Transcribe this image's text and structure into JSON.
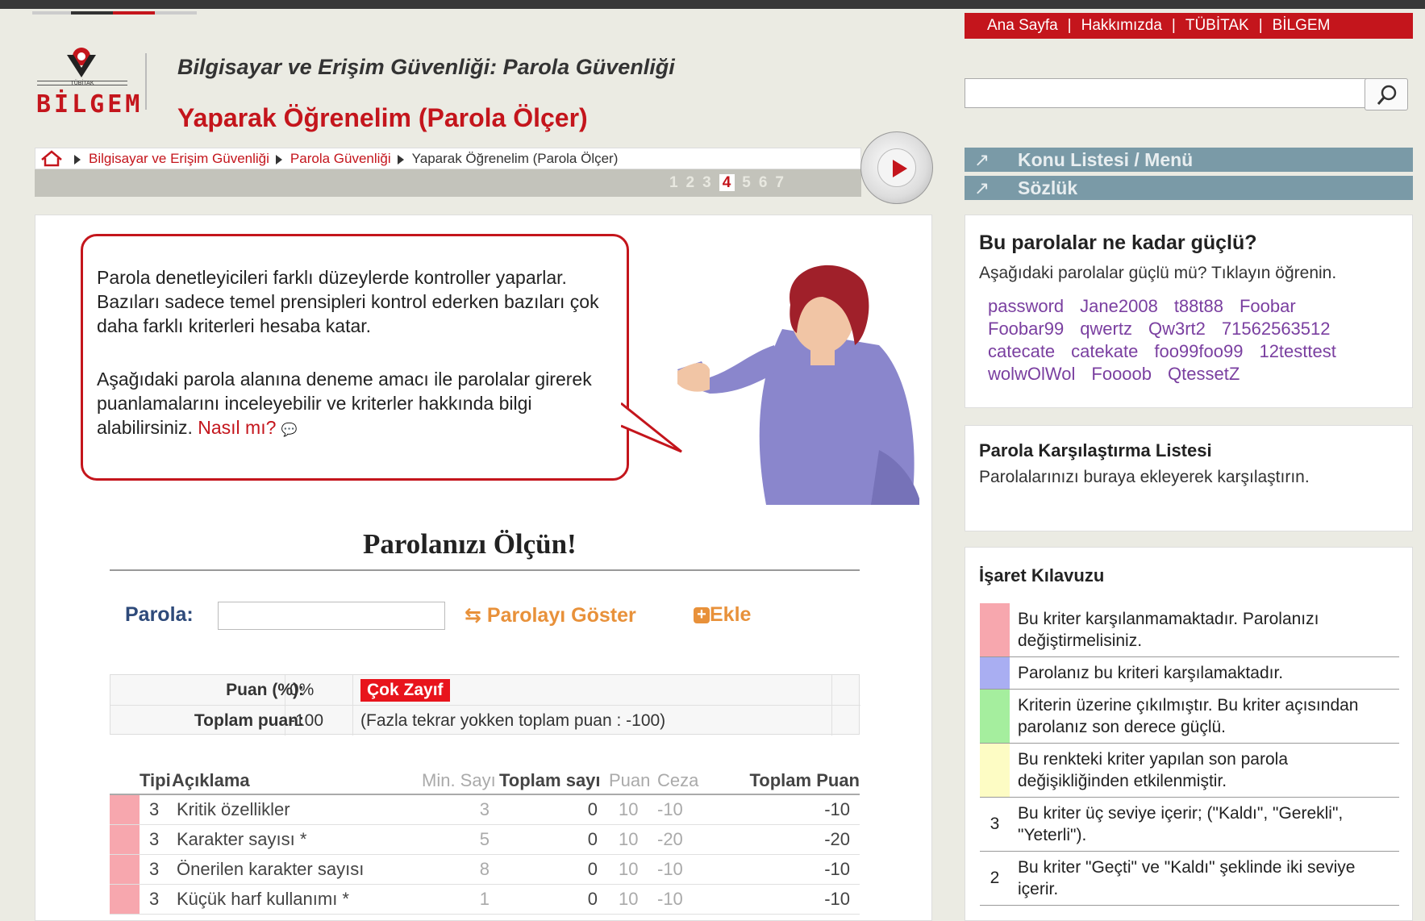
{
  "header": {
    "logo_small": "TÜBİTAK",
    "logo_text": "BİLGEM",
    "site_title": "Bilgisayar ve Erişim Güvenliği: Parola Güvenliği",
    "page_title": "Yaparak Öğrenelim (Parola Ölçer)"
  },
  "topnav": {
    "items": [
      "Ana Sayfa",
      "Hakkımızda",
      "TÜBİTAK",
      "BİLGEM"
    ],
    "separator": "|"
  },
  "search": {
    "placeholder": "",
    "value": ""
  },
  "breadcrumb": {
    "items": [
      "Bilgisayar ve Erişim Güvenliği",
      "Parola Güvenliği",
      "Yaparak Öğrenelim (Parola Ölçer)"
    ]
  },
  "pager": {
    "pages": [
      "1",
      "2",
      "3",
      "4",
      "5",
      "6",
      "7"
    ],
    "current": "4"
  },
  "bubble": {
    "para1": "Parola denetleyicileri farklı düzeylerde kontroller yaparlar. Bazıları sadece temel prensipleri kontrol ederken bazıları çok daha farklı kriterleri hesaba katar.",
    "para2": "Aşağıdaki parola alanına deneme amacı ile parolalar girerek puanlamalarını inceleyebilir ve kriterler hakkında bilgi alabilirsiniz.",
    "link": "Nasıl mı?"
  },
  "meter": {
    "title": "Parolanızı Ölçün!",
    "password_label": "Parola:",
    "password_value": "",
    "show_label": "Parolayı Göster",
    "add_label": "Ekle"
  },
  "score": {
    "percent_label": "Puan (%):",
    "percent_value": "0%",
    "strength": "Çok Zayıf",
    "total_label": "Toplam puan:",
    "total_value": "-100",
    "note": "(Fazla tekrar yokken toplam puan  :  -100)"
  },
  "criteria": {
    "headers": [
      "Tipi",
      "Açıklama",
      "Min. Sayı",
      "Toplam sayı",
      "Puan",
      "Ceza",
      "Toplam Puan"
    ],
    "rows": [
      {
        "type": "3",
        "desc": "Kritik özellikler",
        "min": "3",
        "count": "0",
        "point": "10",
        "penalty": "-10",
        "total": "-10"
      },
      {
        "type": "3",
        "desc": "Karakter sayısı *",
        "min": "5",
        "count": "0",
        "point": "10",
        "penalty": "-20",
        "total": "-20"
      },
      {
        "type": "3",
        "desc": "Önerilen karakter sayısı",
        "min": "8",
        "count": "0",
        "point": "10",
        "penalty": "-10",
        "total": "-10"
      },
      {
        "type": "3",
        "desc": "Küçük harf kullanımı *",
        "min": "1",
        "count": "0",
        "point": "10",
        "penalty": "-10",
        "total": "-10"
      }
    ],
    "row_color": "#f7a7ae"
  },
  "sidebar": {
    "menu": [
      "Konu Listesi / Menü",
      "Sözlük"
    ],
    "strength_panel": {
      "title": "Bu parolalar ne kadar güçlü?",
      "subtitle": "Aşağıdaki parolalar güçlü mü? Tıklayın öğrenin.",
      "passwords": [
        "password",
        "Jane2008",
        "t88t88",
        "Foobar",
        "Foobar99",
        "qwertz",
        "Qw3rt2",
        "71562563512",
        "catecate",
        "catekate",
        "foo99foo99",
        "12testtest",
        "wolwOlWol",
        "Foooob",
        "QtessetZ"
      ]
    },
    "compare_panel": {
      "title": "Parola Karşılaştırma Listesi",
      "text": "Parolalarınızı buraya ekleyerek karşılaştırın."
    },
    "legend_panel": {
      "title": "İşaret Kılavuzu",
      "items": [
        {
          "color": "#f7a7ae",
          "marker": "",
          "text": "Bu kriter karşılanmamaktadır. Parolanızı değiştirmelisiniz."
        },
        {
          "color": "#a9aef2",
          "marker": "",
          "text": "Parolanız bu kriteri karşılamaktadır."
        },
        {
          "color": "#a5ee9e",
          "marker": "",
          "text": "Kriterin üzerine çıkılmıştır. Bu kriter açısından parolanız son derece güçlü."
        },
        {
          "color": "#fdfcc4",
          "marker": "",
          "text": "Bu renkteki kriter yapılan son parola değişikliğinden etkilenmiştir."
        },
        {
          "color": "",
          "marker": "3",
          "text": "Bu kriter üç seviye içerir; (\"Kaldı\", \"Gerekli\", \"Yeterli\")."
        },
        {
          "color": "",
          "marker": "2",
          "text": "Bu kriter \"Geçti\" ve \"Kaldı\" şeklinde iki seviye içerir."
        }
      ]
    }
  },
  "colors": {
    "brand_red": "#c4151c",
    "accent_orange": "#e8913a",
    "menu_blue": "#7a9aa7",
    "label_blue": "#2e4a7a"
  }
}
